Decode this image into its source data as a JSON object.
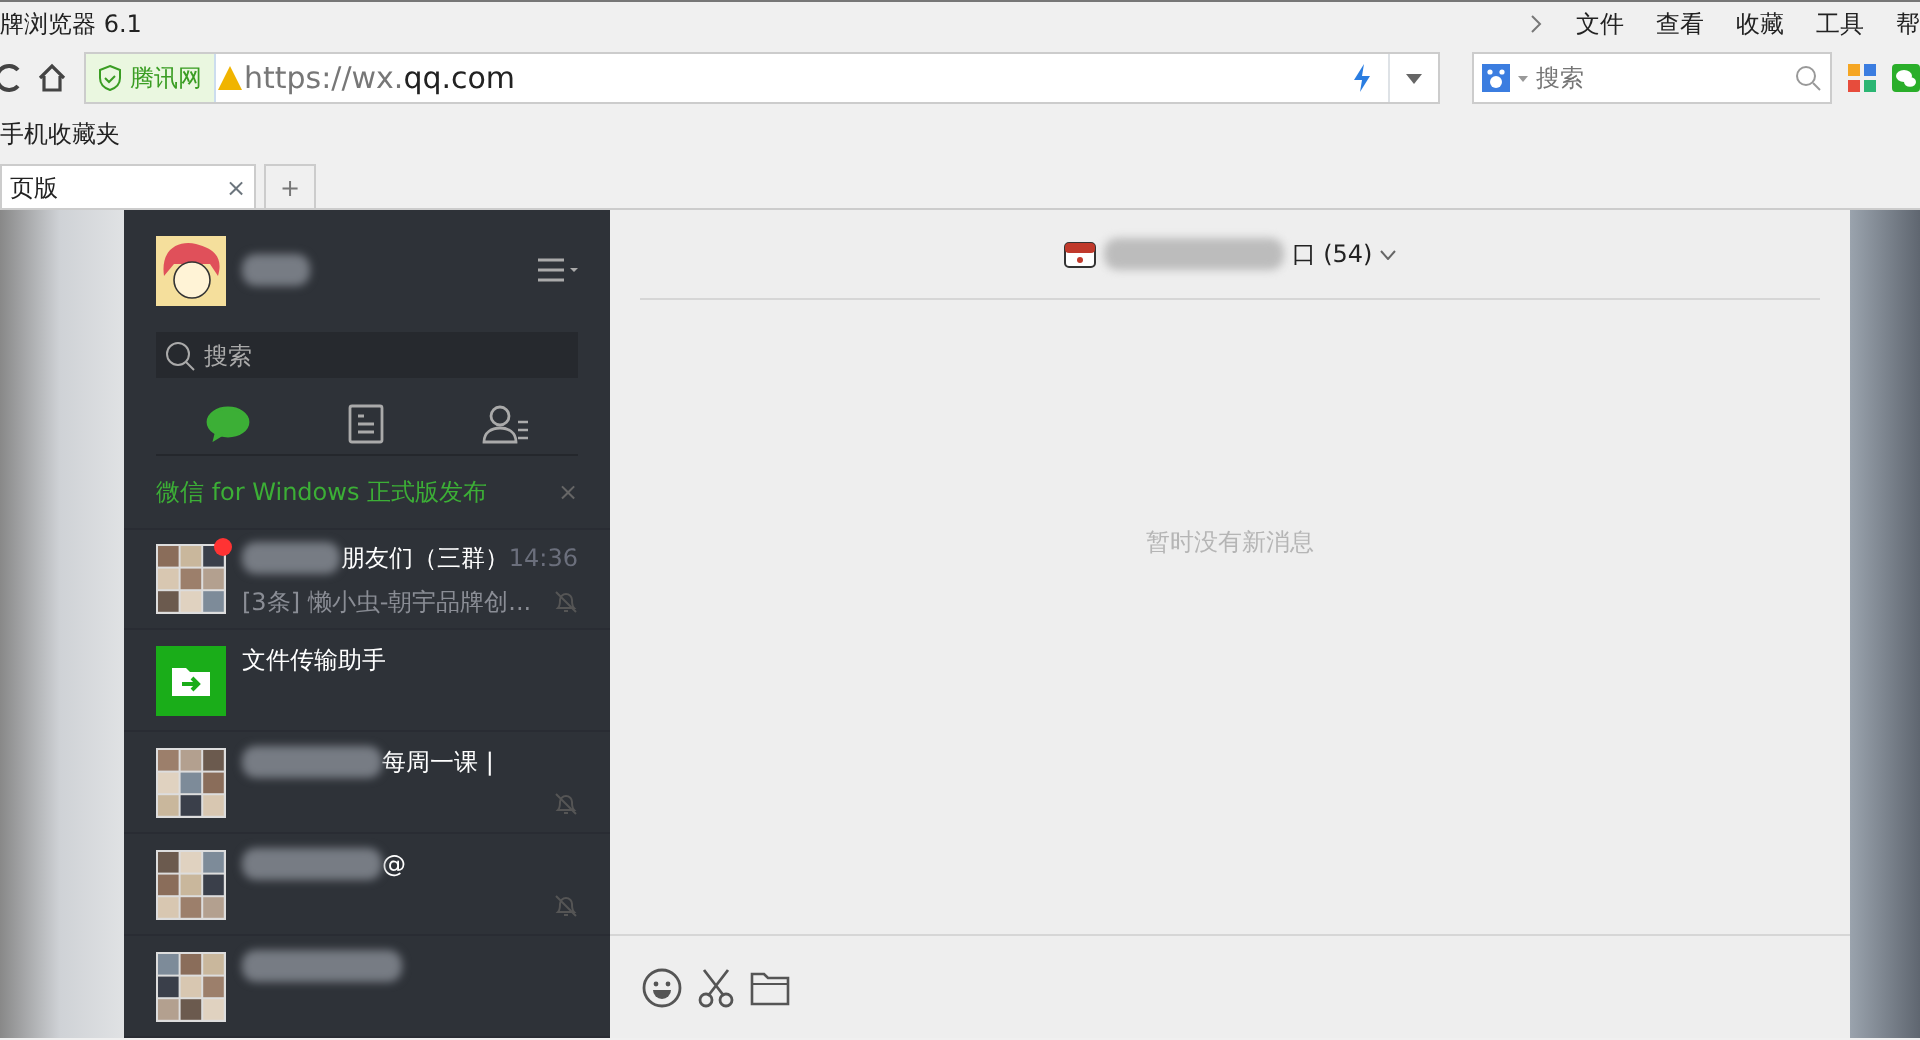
{
  "browser": {
    "title": "牌浏览器 6.1",
    "menu": [
      "文件",
      "查看",
      "收藏",
      "工具",
      "帮"
    ],
    "security_badge": "腾讯网",
    "url_scheme": "https://wx.",
    "url_domain": "qq.com",
    "search": {
      "placeholder": "搜索"
    },
    "bookmarks": [
      "手机收藏夹"
    ],
    "tabs": [
      {
        "label": "页版",
        "selected": true,
        "close": "×"
      }
    ],
    "new_tab": "+"
  },
  "wechat": {
    "profile": {
      "name_obscured": true
    },
    "search": {
      "placeholder": "搜索"
    },
    "nav": [
      {
        "kind": "chats",
        "selected": true
      },
      {
        "kind": "articles",
        "selected": false
      },
      {
        "kind": "contacts",
        "selected": false
      }
    ],
    "banner": {
      "text": "微信 for Windows 正式版发布",
      "close": "×"
    },
    "chats": [
      {
        "kind": "group",
        "name_obscured": true,
        "name": "朋友们（三群）",
        "time": "14:36",
        "preview": "[3条] 懒小虫-朝宇品牌创...",
        "unread": true,
        "muted": true
      },
      {
        "kind": "file",
        "name_obscured": false,
        "name": "文件传输助手",
        "unread": false,
        "muted": false
      },
      {
        "kind": "group",
        "name_obscured": true,
        "name": "每周一课 |",
        "unread": false,
        "muted": true
      },
      {
        "kind": "group",
        "name_obscured": true,
        "name": "@",
        "unread": false,
        "muted": true
      },
      {
        "kind": "group",
        "name_obscured": true,
        "unread": false,
        "muted": false
      }
    ],
    "conversation": {
      "title_obscured": true,
      "title_end": "口",
      "member_count": "(54)",
      "empty_text": "暂时没有新消息"
    }
  }
}
